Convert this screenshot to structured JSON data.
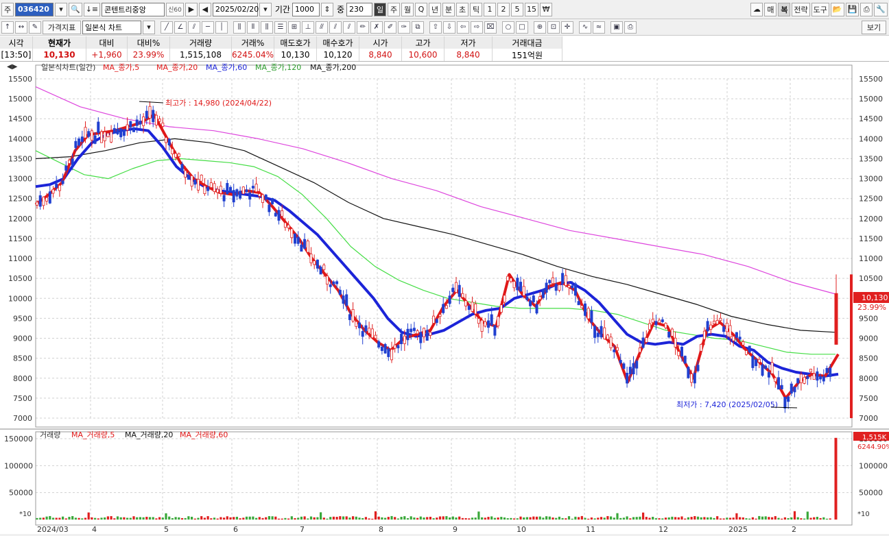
{
  "toolbar": {
    "mode_label": "주",
    "code": "036420",
    "stock_name": "콘텐트리중앙",
    "badge": "신60",
    "date": "2025/02/20",
    "period_label": "기간",
    "period_value": "1000",
    "overlap_label": "중",
    "overlap_value": "230",
    "intervals": [
      "일",
      "주",
      "월",
      "Q",
      "년",
      "분",
      "초",
      "틱",
      "1",
      "2",
      "5",
      "15",
      "₩"
    ],
    "selected_interval": "일",
    "right_buttons": [
      "매",
      "복",
      "전략",
      "도구"
    ],
    "second_label_1": "가격지표",
    "chart_type": "일본식 차트",
    "view_button": "보기"
  },
  "quote": {
    "headers": [
      "시각",
      "현재가",
      "대비",
      "대비%",
      "거래량",
      "거래%",
      "매도호가",
      "매수호가",
      "시가",
      "고가",
      "저가",
      "거래대금"
    ],
    "values": [
      "[13:50]",
      "10,130",
      "+1,960",
      "23.99%",
      "1,515,108",
      "6245.04%",
      "10,130",
      "10,120",
      "8,840",
      "10,600",
      "8,840",
      "151억원"
    ]
  },
  "colors": {
    "up": "#e02020",
    "down": "#2040d0",
    "ma5": "#e01818",
    "ma20": "#1c24d8",
    "ma60": "#44dd44",
    "ma120": "#111111",
    "ma200": "#dd44dd"
  },
  "legend": {
    "title": "일본식차트(일간)",
    "ma5": "MA_종가,5",
    "ma20": "MA_종가,20",
    "ma60": "MA_종가,60",
    "ma120": "MA_종가,120",
    "ma200": "MA_종가,200"
  },
  "volume_legend": {
    "title": "거래량",
    "ma5": "MA_거래량,5",
    "ma20": "MA_거래량,20",
    "ma60": "MA_거래량,60"
  },
  "annotations": {
    "high": "최고가 : 14,980 (2024/04/22)",
    "low": "최저가 : 7,420 (2025/02/05)",
    "last_price": "10,130",
    "last_pct": "23.99%",
    "last_volume": "1,515K",
    "last_volume_pct": "6244.90%",
    "volume_unit_left": "*10",
    "volume_unit_right": "*10"
  },
  "chart_data": {
    "type": "candlestick",
    "price_axis": {
      "min": 7000,
      "max": 15500,
      "ticks": [
        7000,
        7500,
        8000,
        8500,
        9000,
        9500,
        10000,
        10500,
        11000,
        11500,
        12000,
        12500,
        13000,
        13500,
        14000,
        14500,
        15000,
        15500
      ]
    },
    "volume_axis": {
      "ticks": [
        50000,
        100000,
        150000
      ],
      "tick_labels": [
        "50000",
        "100000",
        "150000"
      ]
    },
    "x_labels": [
      "2024/03",
      "4",
      "5",
      "6",
      "7",
      "8",
      "9",
      "10",
      "11",
      "12",
      "2025",
      "2"
    ],
    "ma5": [
      12350,
      12600,
      12900,
      13700,
      14100,
      14150,
      14200,
      14300,
      14400,
      14600,
      14000,
      13400,
      13000,
      12800,
      12650,
      12600,
      12700,
      12650,
      12300,
      11900,
      11500,
      11000,
      10600,
      10200,
      9600,
      9200,
      8900,
      8700,
      9000,
      9100,
      9200,
      9800,
      10200,
      9800,
      9400,
      9300,
      10600,
      10100,
      9800,
      10300,
      10400,
      10200,
      9500,
      9100,
      8800,
      7900,
      8700,
      9400,
      9300,
      8600,
      8000,
      9200,
      9400,
      9100,
      8700,
      8400,
      8100,
      7500,
      7900,
      8100,
      8050,
      8600
    ],
    "ma20": [
      12800,
      12850,
      13000,
      13500,
      13900,
      14100,
      14200,
      14250,
      14200,
      13800,
      13300,
      13000,
      12800,
      12700,
      12650,
      12600,
      12550,
      12450,
      12200,
      11900,
      11600,
      11200,
      10800,
      10400,
      10000,
      9500,
      9150,
      9050,
      9100,
      9200,
      9400,
      9600,
      9700,
      9750,
      10000,
      10100,
      10200,
      10350,
      10400,
      10200,
      9900,
      9500,
      9100,
      8900,
      8850,
      8900,
      8850,
      9050,
      9100,
      9050,
      8800,
      8700,
      8400,
      8250,
      8150,
      8100,
      8050,
      8100
    ],
    "ma60": [
      13700,
      13400,
      13100,
      13000,
      13250,
      13450,
      13500,
      13450,
      13400,
      13300,
      13050,
      12600,
      12000,
      11300,
      10800,
      10450,
      10200,
      10000,
      9900,
      9800,
      9750,
      9750,
      9750,
      9700,
      9600,
      9400,
      9200,
      9100,
      9000,
      8950,
      8800,
      8650,
      8600,
      8600
    ],
    "ma120": [
      13500,
      13550,
      13700,
      13900,
      14000,
      13900,
      13700,
      13300,
      12900,
      12400,
      12000,
      11800,
      11600,
      11350,
      11100,
      10800,
      10550,
      10350,
      10100,
      9850,
      9550,
      9350,
      9200,
      9150
    ],
    "ma200": [
      15300,
      14800,
      14500,
      14300,
      14200,
      14000,
      13750,
      13400,
      13000,
      12700,
      12300,
      12000,
      11700,
      11500,
      11300,
      11100,
      10800,
      10400,
      10100
    ],
    "last_candle": {
      "open": 8840,
      "high": 10600,
      "low": 8840,
      "close": 10130
    },
    "last_volume": 1515108
  }
}
